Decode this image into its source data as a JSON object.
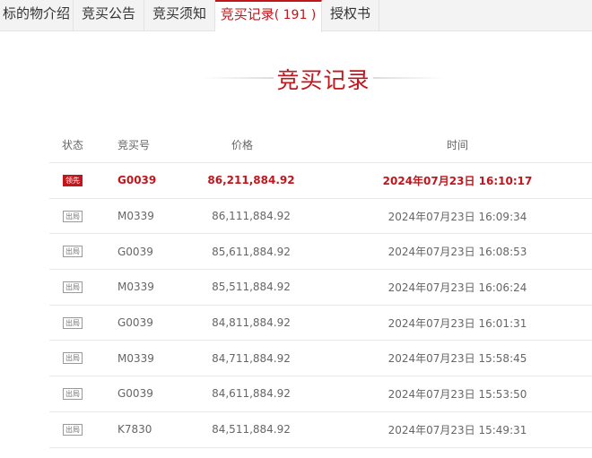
{
  "tabs": [
    {
      "label": "标的物介绍",
      "active": false
    },
    {
      "label": "竞买公告",
      "active": false
    },
    {
      "label": "竞买须知",
      "active": false
    },
    {
      "label": "竞买记录",
      "count": "( 191 )",
      "active": true
    },
    {
      "label": "授权书",
      "active": false
    }
  ],
  "section_title": "竞买记录",
  "table": {
    "headers": {
      "status": "状态",
      "code": "竞买号",
      "price": "价格",
      "time": "时间"
    },
    "rows": [
      {
        "status": "领先",
        "code": "G0039",
        "price": "86,211,884.92",
        "time": "2024年07月23日 16:10:17"
      },
      {
        "status": "出局",
        "code": "M0339",
        "price": "86,111,884.92",
        "time": "2024年07月23日 16:09:34"
      },
      {
        "status": "出局",
        "code": "G0039",
        "price": "85,611,884.92",
        "time": "2024年07月23日 16:08:53"
      },
      {
        "status": "出局",
        "code": "M0339",
        "price": "85,511,884.92",
        "time": "2024年07月23日 16:06:24"
      },
      {
        "status": "出局",
        "code": "G0039",
        "price": "84,811,884.92",
        "time": "2024年07月23日 16:01:31"
      },
      {
        "status": "出局",
        "code": "M0339",
        "price": "84,711,884.92",
        "time": "2024年07月23日 15:58:45"
      },
      {
        "status": "出局",
        "code": "G0039",
        "price": "84,611,884.92",
        "time": "2024年07月23日 15:53:50"
      },
      {
        "status": "出局",
        "code": "K7830",
        "price": "84,511,884.92",
        "time": "2024年07月23日 15:49:31"
      }
    ]
  },
  "colors": {
    "accent": "#c0161c",
    "tab_bg": "#f3f3f3",
    "text_muted": "#666666"
  }
}
